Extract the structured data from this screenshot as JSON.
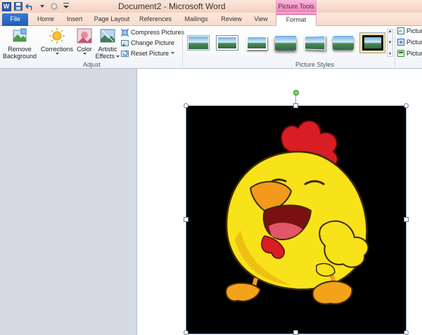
{
  "window": {
    "title": "Document2  -  Microsoft Word",
    "context_header": "Picture Tools"
  },
  "tabs": [
    {
      "label": "File"
    },
    {
      "label": "Home"
    },
    {
      "label": "Insert"
    },
    {
      "label": "Page Layout"
    },
    {
      "label": "References"
    },
    {
      "label": "Mailings"
    },
    {
      "label": "Review"
    },
    {
      "label": "View"
    },
    {
      "label": "Format"
    }
  ],
  "ribbon": {
    "remove_background": {
      "line1": "Remove",
      "line2": "Background"
    },
    "corrections": "Corrections",
    "color": "Color",
    "artistic_effects": {
      "line1": "Artistic",
      "line2": "Effects"
    },
    "compress_pictures": "Compress Pictures",
    "change_picture": "Change Picture",
    "reset_picture": "Reset Picture",
    "adjust_group": "Adjust",
    "picture_styles_group": "Picture Styles",
    "right_items": [
      "Pictur",
      "Pictur",
      "Pictur"
    ]
  },
  "colors": {
    "accent_file": "#1f5bb8",
    "context_pink": "#ee7fb7",
    "image_bg": "#000000"
  },
  "icons": [
    "word-icon",
    "save-icon",
    "undo-icon",
    "redo-icon"
  ]
}
